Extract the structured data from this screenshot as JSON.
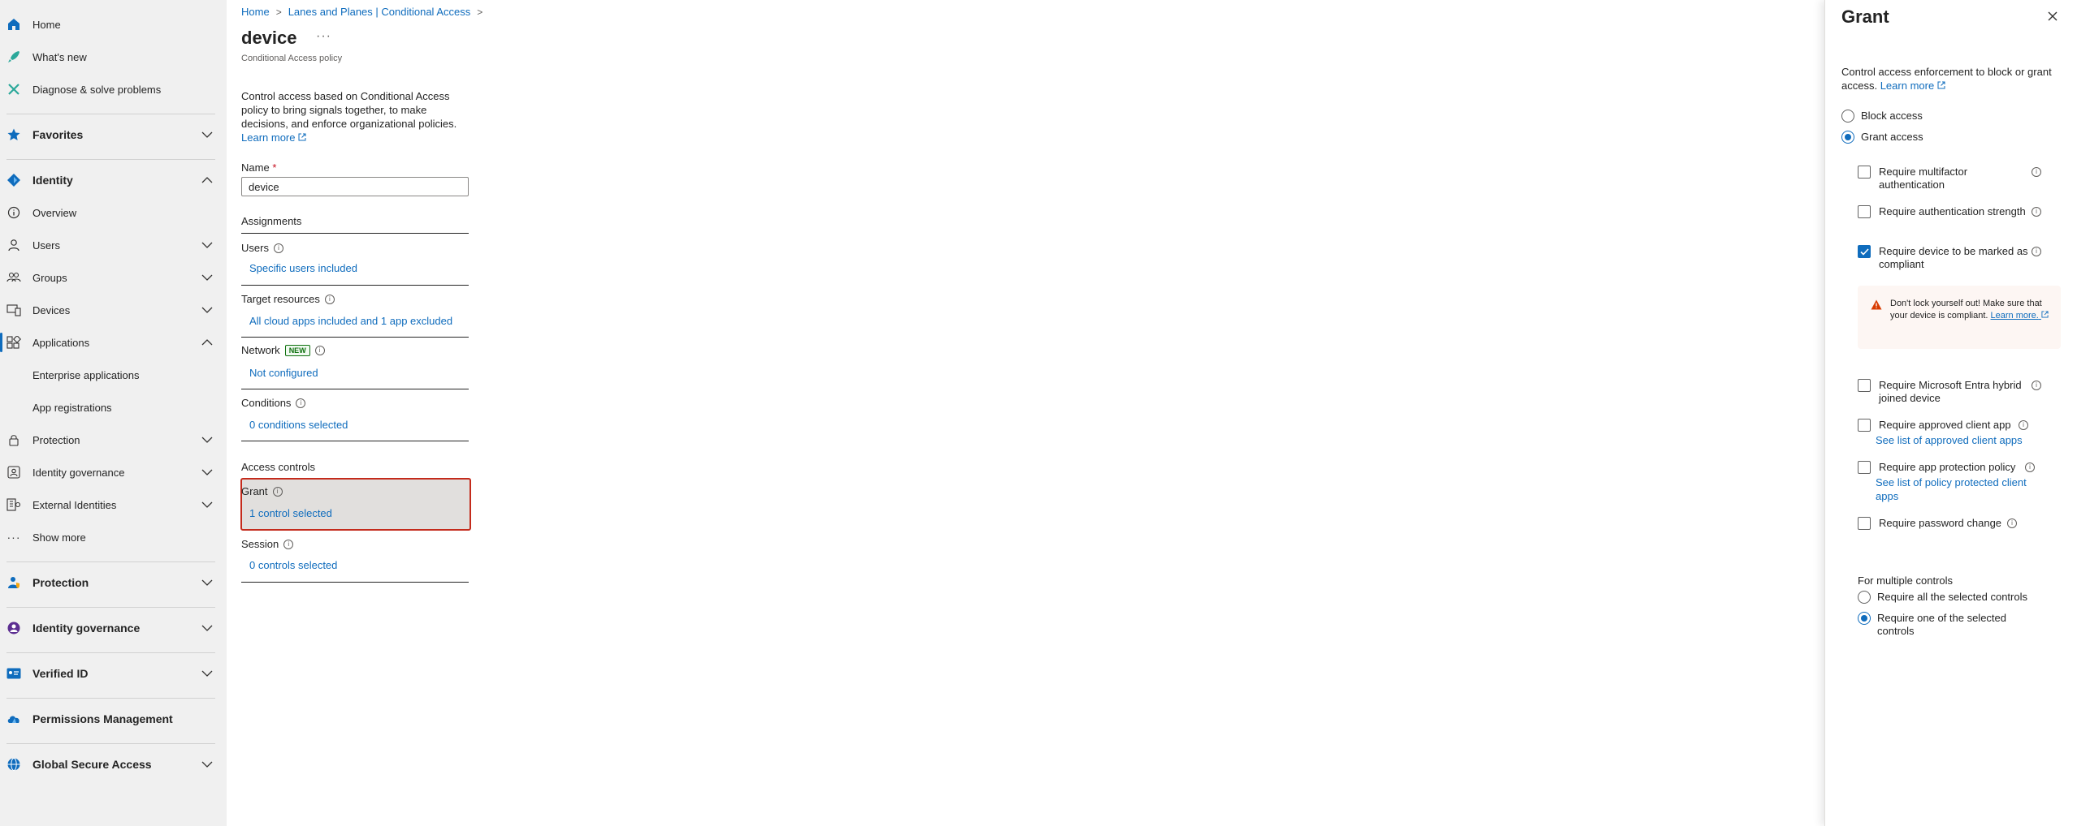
{
  "sidebar": {
    "items": [
      {
        "label": "Home",
        "icon": "home-icon",
        "bold": false
      },
      {
        "label": "What's new",
        "icon": "rocket-icon"
      },
      {
        "label": "Diagnose & solve problems",
        "icon": "wrench-icon"
      },
      {
        "label": "Favorites",
        "icon": "star-icon"
      },
      {
        "label": "Identity",
        "icon": "identity-diamond-icon"
      },
      {
        "label": "Overview",
        "icon": "info-icon"
      },
      {
        "label": "Users",
        "icon": "user-icon"
      },
      {
        "label": "Groups",
        "icon": "groups-icon"
      },
      {
        "label": "Devices",
        "icon": "devices-icon"
      },
      {
        "label": "Applications",
        "icon": "applications-icon"
      },
      {
        "label": "Enterprise applications"
      },
      {
        "label": "App registrations"
      },
      {
        "label": "Protection",
        "icon": "lock-icon"
      },
      {
        "label": "Identity governance",
        "icon": "governance-icon"
      },
      {
        "label": "External Identities",
        "icon": "external-identities-icon"
      },
      {
        "label": "Show more",
        "icon": "more-icon"
      },
      {
        "label": "Protection",
        "icon": "protection-person-icon"
      },
      {
        "label": "Identity governance",
        "icon": "governance-color-icon"
      },
      {
        "label": "Verified ID",
        "icon": "verified-id-icon"
      },
      {
        "label": "Permissions Management",
        "icon": "cloud-icon"
      },
      {
        "label": "Global Secure Access",
        "icon": "globe-icon"
      }
    ]
  },
  "breadcrumb": {
    "home": "Home",
    "parent": "Lanes and Planes | Conditional Access"
  },
  "page": {
    "title": "device",
    "more": "···",
    "subtitle": "Conditional Access policy",
    "description": "Control access based on Conditional Access policy to bring signals together, to make decisions, and enforce organizational policies.",
    "learn_more": "Learn more",
    "name_label": "Name",
    "name_required": "*",
    "name_value": "device",
    "assignments": "Assignments",
    "users_label": "Users",
    "users_value": "Specific users included",
    "target_label": "Target resources",
    "target_value": "All cloud apps included and 1 app excluded",
    "network_label": "Network",
    "network_badge": "NEW",
    "network_value": "Not configured",
    "conditions_label": "Conditions",
    "conditions_value": "0 conditions selected",
    "access_controls": "Access controls",
    "grant_label": "Grant",
    "grant_value": "1 control selected",
    "session_label": "Session",
    "session_value": "0 controls selected"
  },
  "panel": {
    "title": "Grant",
    "description": "Control access enforcement to block or grant access.",
    "learn_more": "Learn more",
    "block_access": "Block access",
    "grant_access": "Grant access",
    "grant_selected": true,
    "controls": {
      "mfa": {
        "label": "Require multifactor authentication",
        "checked": false
      },
      "auth_strength": {
        "label": "Require authentication strength",
        "checked": false
      },
      "compliant": {
        "label": "Require device to be marked as compliant",
        "checked": true
      },
      "hybrid": {
        "label": "Require Microsoft Entra hybrid joined device",
        "checked": false
      },
      "approved_app": {
        "label": "Require approved client app",
        "link": "See list of approved client apps",
        "checked": false
      },
      "app_protection": {
        "label": "Require app protection policy",
        "link": "See list of policy protected client apps",
        "checked": false
      },
      "password_change": {
        "label": "Require password change",
        "checked": false
      }
    },
    "warning_text": "Don't lock yourself out! Make sure that your device is compliant.",
    "warning_link": "Learn more.",
    "multiple_label": "For multiple controls",
    "require_all": "Require all the selected controls",
    "require_one": "Require one of the selected controls",
    "require_one_selected": true
  },
  "colors": {
    "accent": "#0f6cbd",
    "highlight_border": "#c42b1c",
    "warning": "#d83b01"
  }
}
